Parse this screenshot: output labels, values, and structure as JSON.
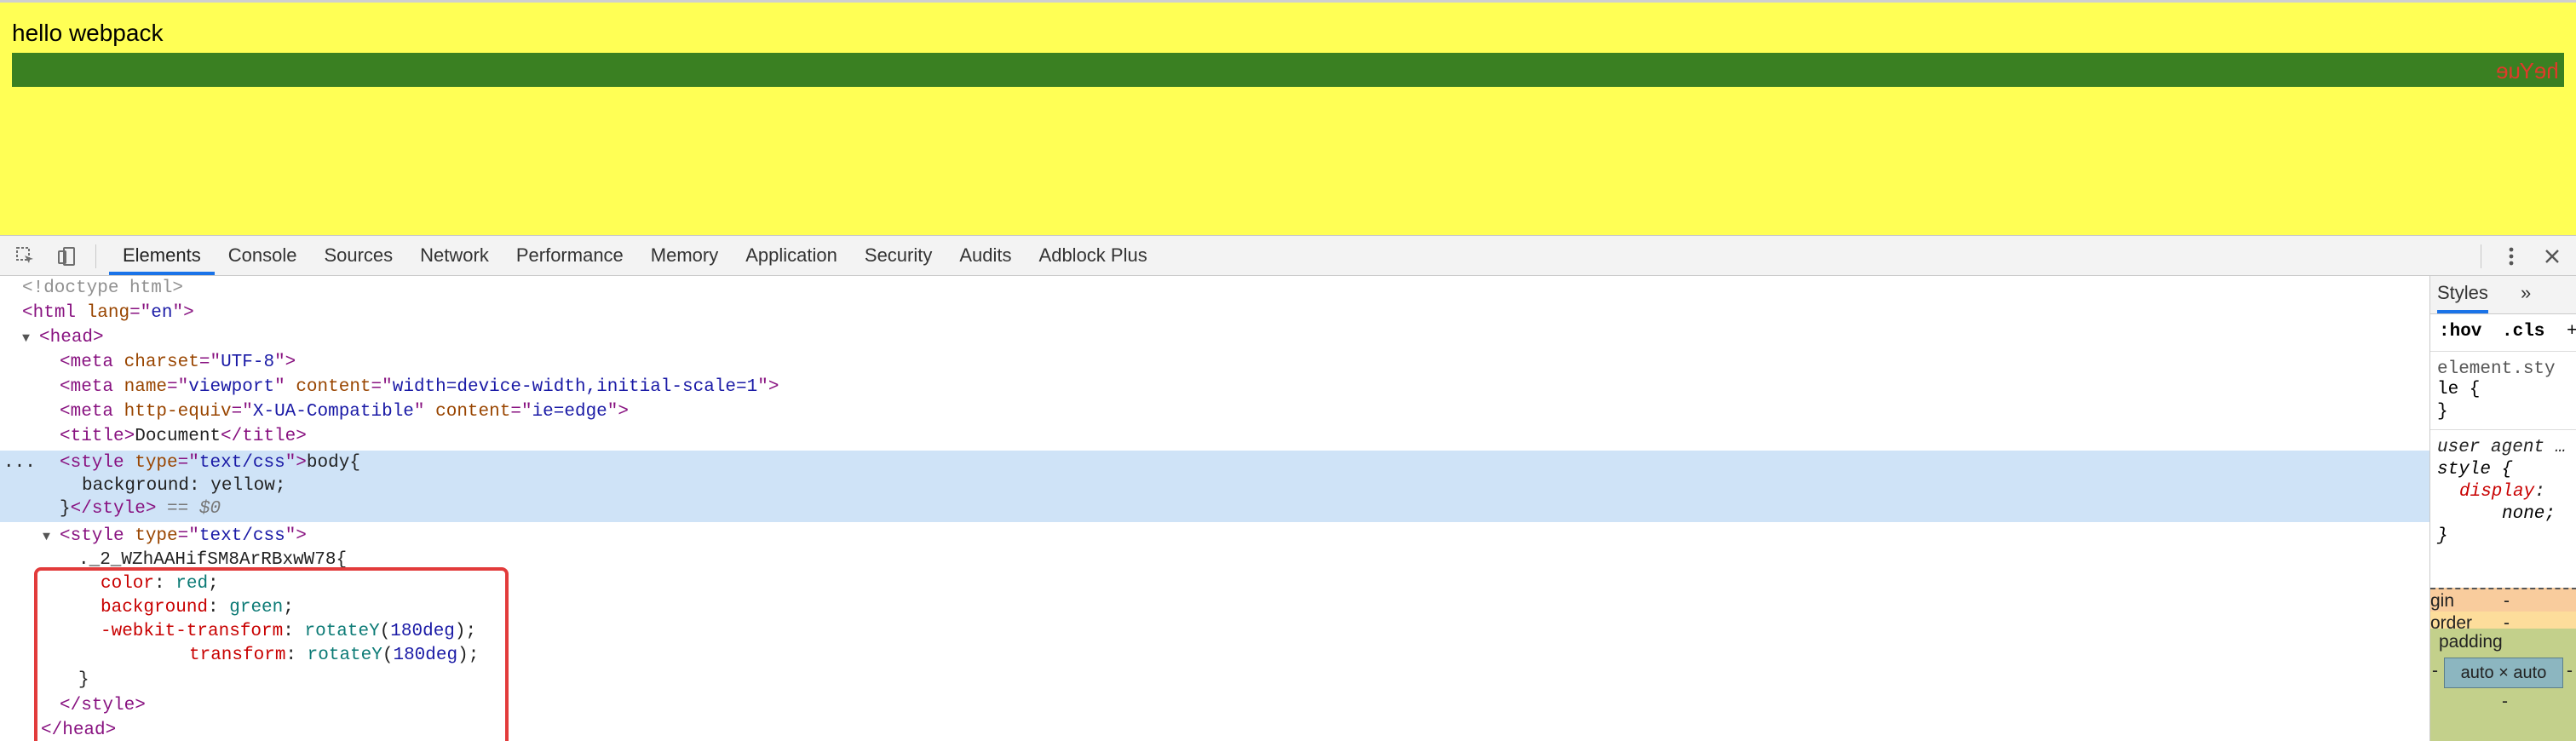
{
  "page": {
    "heading": "hello webpack",
    "flipped_text": "heYue"
  },
  "devtools": {
    "tabs": [
      "Elements",
      "Console",
      "Sources",
      "Network",
      "Performance",
      "Memory",
      "Application",
      "Security",
      "Audits",
      "Adblock Plus"
    ],
    "active_tab": "Elements",
    "icons": {
      "inspect": "inspect-element-icon",
      "device": "device-toolbar-icon",
      "more": "kebab-menu-icon",
      "close": "close-icon"
    }
  },
  "tree": {
    "doctype": "<!doctype html>",
    "html_open": {
      "tag": "html",
      "attr": "lang",
      "val": "en"
    },
    "head_open": "head",
    "meta_charset": {
      "attr": "charset",
      "val": "UTF-8"
    },
    "meta_viewport": {
      "attr1": "name",
      "val1": "viewport",
      "attr2": "content",
      "val2": "width=device-width,initial-scale=1"
    },
    "meta_xua": {
      "attr1": "http-equiv",
      "val1": "X-UA-Compatible",
      "attr2": "content",
      "val2": "ie=edge"
    },
    "title_text": "Document",
    "style1": {
      "type_val": "text/css",
      "line1_text": "body{",
      "line2_prop": "background",
      "line2_val": "yellow",
      "selected_marker": "== $0"
    },
    "style2": {
      "type_val": "text/css",
      "selector": "._2_WZhAAHifSM8ArRBxwW78{",
      "decls": [
        {
          "prop": "color",
          "val": "red"
        },
        {
          "prop": "background",
          "val": "green"
        },
        {
          "prop": "-webkit-transform",
          "fn": "rotateY",
          "arg": "180deg"
        },
        {
          "prop": "transform",
          "fn": "rotateY",
          "arg": "180deg"
        }
      ],
      "close_brace": "}"
    },
    "head_close": "head",
    "ellipsis": "..."
  },
  "styles_panel": {
    "tab_styles": "Styles",
    "tab_more": "»",
    "filter_hov": ":hov",
    "filter_cls": ".cls",
    "filter_plus": "+",
    "element_style_l1": "element.sty",
    "element_style_l2": "le {",
    "element_style_close": "}",
    "ua_l1": "user agent …",
    "ua_l2": "style {",
    "ua_decl_prop": "display",
    "ua_decl_val": "none;",
    "ua_close": "}",
    "box_margin_label": "gin",
    "box_margin_val": "-",
    "box_border_label": "order",
    "box_border_val": "-",
    "box_padding_label": "padding",
    "box_padding_left": "-",
    "box_padding_bottom": "-",
    "box_content": "auto × auto",
    "box_content_right": "-"
  }
}
